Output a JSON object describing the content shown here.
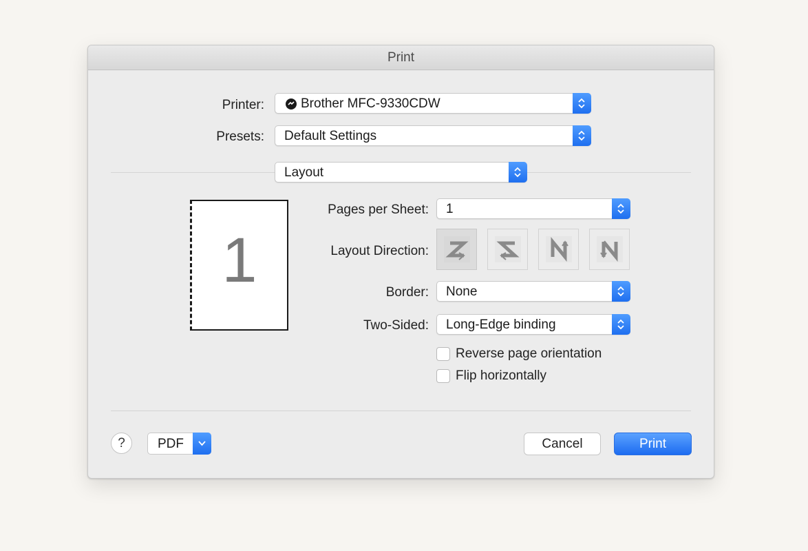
{
  "dialog": {
    "title": "Print"
  },
  "printer": {
    "label": "Printer:",
    "value": "Brother MFC-9330CDW",
    "status_icon": "printer-status-icon"
  },
  "presets": {
    "label": "Presets:",
    "value": "Default Settings"
  },
  "section": {
    "value": "Layout"
  },
  "preview": {
    "page_number": "1"
  },
  "pages_per_sheet": {
    "label": "Pages per Sheet:",
    "value": "1"
  },
  "layout_direction": {
    "label": "Layout Direction:",
    "options": [
      "z-left-to-right",
      "z-right-to-left",
      "n-top-to-bottom-left",
      "n-top-to-bottom-right"
    ],
    "selected": 0
  },
  "border": {
    "label": "Border:",
    "value": "None"
  },
  "two_sided": {
    "label": "Two-Sided:",
    "value": "Long-Edge binding"
  },
  "checkboxes": {
    "reverse": {
      "label": "Reverse page orientation",
      "checked": false
    },
    "flip": {
      "label": "Flip horizontally",
      "checked": false
    }
  },
  "footer": {
    "help_label": "?",
    "pdf_label": "PDF",
    "cancel_label": "Cancel",
    "print_label": "Print"
  },
  "colors": {
    "accent": "#1f6fef",
    "background": "#ececec"
  }
}
